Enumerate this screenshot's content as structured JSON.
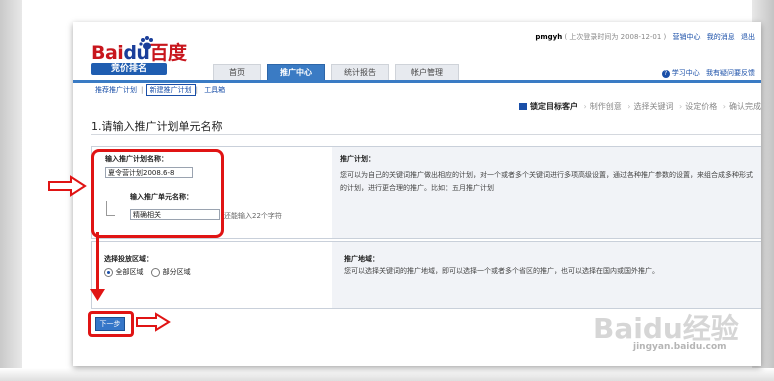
{
  "app": {
    "logo_text_red": "Bai",
    "logo_text_blue": "du",
    "logo_text_cn": "百度",
    "logo_badge": "竞价排名"
  },
  "userbar": {
    "username": "pmgyh",
    "last_login": "( 上次登录时间为 2008-12-01 )",
    "links": [
      "营销中心",
      "我的消息",
      "退出"
    ]
  },
  "tabs": [
    {
      "label": "首页",
      "active": false
    },
    {
      "label": "推广中心",
      "active": true
    },
    {
      "label": "统计报告",
      "active": false
    },
    {
      "label": "帐户管理",
      "active": false
    }
  ],
  "help_links": [
    "学习中心",
    "我有疑问要反馈"
  ],
  "subnav": [
    {
      "label": "推荐推广计划",
      "active": false
    },
    {
      "label": "新建推广计划",
      "active": true
    },
    {
      "label": "工具箱",
      "active": false
    }
  ],
  "steps": [
    {
      "label": "锁定目标客户",
      "current": true
    },
    {
      "label": "制作创意",
      "current": false
    },
    {
      "label": "选择关键词",
      "current": false
    },
    {
      "label": "设定价格",
      "current": false
    },
    {
      "label": "确认完成",
      "current": false
    }
  ],
  "section_heading": "1.请输入推广计划单元名称",
  "form": {
    "plan_name_label": "输入推广计划名称：",
    "plan_name_value": "夏令营计划2008.6-8",
    "unit_name_label": "输入推广单元名称：",
    "unit_name_value": "精确相关",
    "unit_hint": "还能输入22个字符",
    "region_label": "选择投放区域：",
    "region_options": [
      {
        "label": "全部区域",
        "checked": true
      },
      {
        "label": "部分区域",
        "checked": false
      }
    ],
    "next_button": "下一步"
  },
  "info": {
    "plan_title": "推广计划：",
    "plan_text": "您可以为自己的关键词推广做出相应的计划，对一个或者多个关键词进行多项高级设置，通过各种推广参数的设置，来组合成多种形式的计划，进行更合理的推广。比如：五月推广计划",
    "region_title": "推广地域：",
    "region_text": "您可以选择关键词的推广地域，即可以选择一个或者多个省区的推广，也可以选择在国内或国外推广。"
  },
  "watermark": {
    "brand": "Baidu经验",
    "url": "jingyan.baidu.com"
  },
  "colors": {
    "accent_blue": "#3a7bc4",
    "annotation_red": "#e01414",
    "logo_red": "#c8161d"
  }
}
